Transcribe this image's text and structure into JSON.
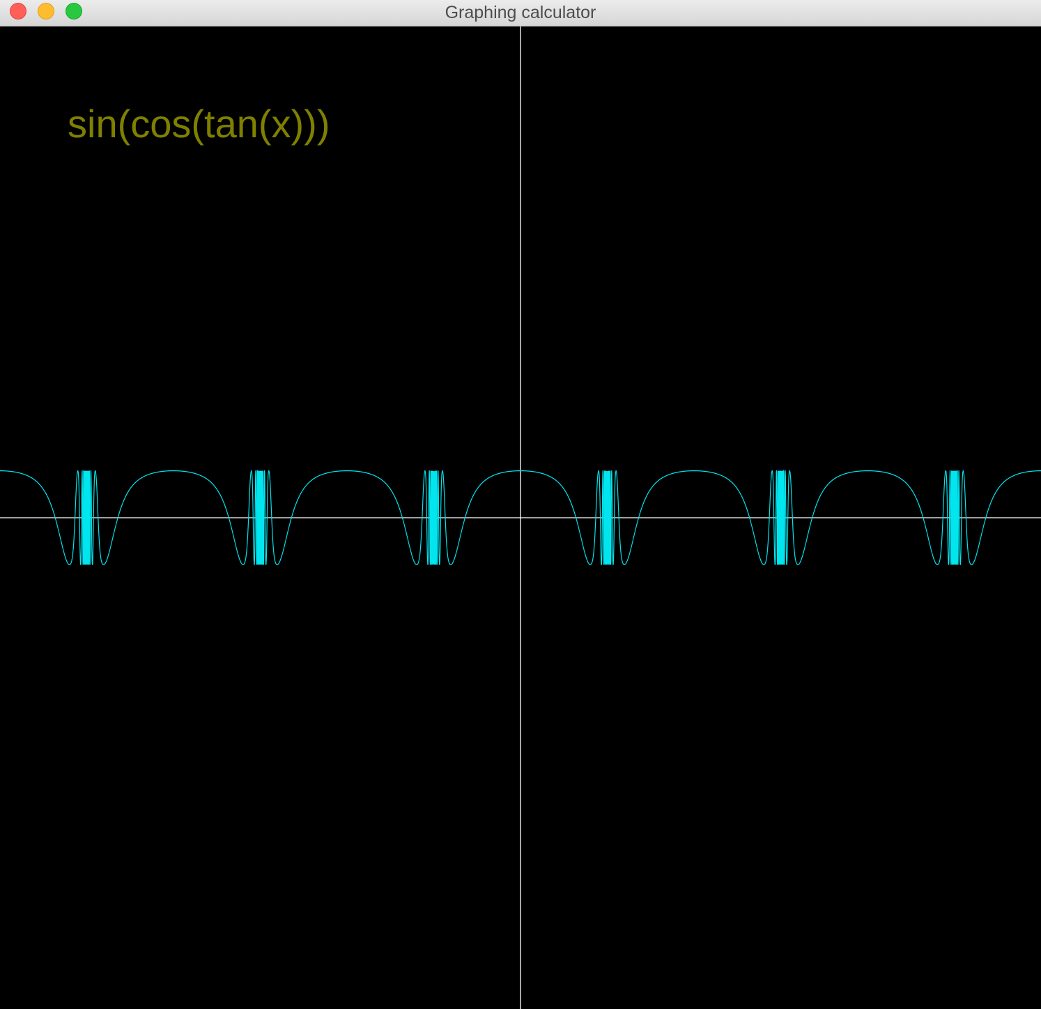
{
  "window": {
    "title": "Graphing calculator"
  },
  "graph": {
    "expression": "sin(cos(tan(x)))",
    "expression_color": "#808000",
    "curve_color": "#00e5ee",
    "axis_color": "#ffffff",
    "background_color": "#000000",
    "x_range": [
      -9.42,
      9.42
    ],
    "y_range": [
      -8.8,
      8.8
    ]
  },
  "chart_data": {
    "type": "line",
    "title": "sin(cos(tan(x)))",
    "xlabel": "",
    "ylabel": "",
    "xlim": [
      -9.42,
      9.42
    ],
    "ylim": [
      -8.8,
      8.8
    ],
    "grid": false,
    "series": [
      {
        "function": "sin(cos(tan(x)))"
      }
    ]
  }
}
